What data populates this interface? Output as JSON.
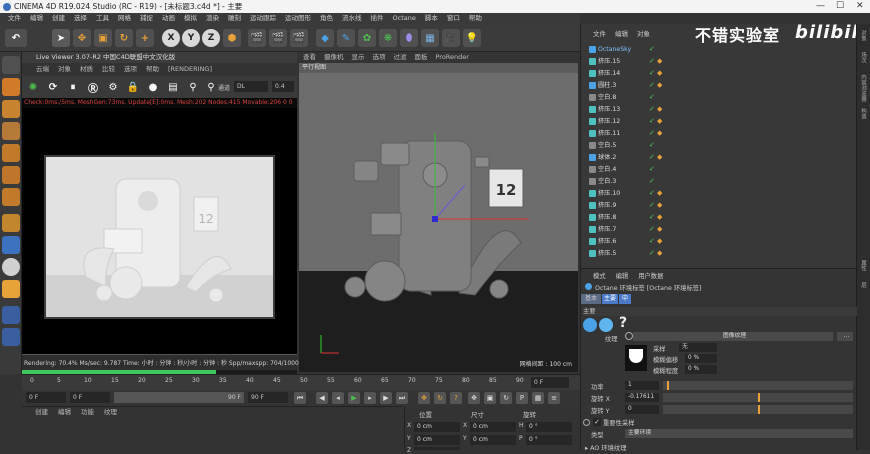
{
  "app": {
    "title": "CINEMA 4D R19.024 Studio (RC - R19) - [未标题3.c4d *] - 主要",
    "menu": [
      "文件",
      "编辑",
      "创建",
      "选择",
      "工具",
      "网格",
      "捕捉",
      "动画",
      "模拟",
      "渲染",
      "雕刻",
      "运动跟踪",
      "运动图形",
      "角色",
      "流水线",
      "插件",
      "Octane",
      "脚本",
      "窗口",
      "帮助"
    ]
  },
  "window_controls": {
    "minimize": "—",
    "maximize": "☐",
    "close": "✕"
  },
  "toolbar": {
    "axis_x": "X",
    "axis_y": "Y",
    "axis_z": "Z"
  },
  "live_viewer": {
    "title": "Live Viewer 3.07-R2 中国C4D联盟中文汉化版",
    "menu": [
      "云端",
      "对象",
      "材质",
      "比较",
      "选项",
      "帮助",
      "[RENDERING]"
    ],
    "channel_label": "通道",
    "channel_value": "DL",
    "channel_number": "0.4",
    "status": "Check:0ms./5ms. MeshGen:73ms. Update[E]:0ms. Mesh:202 Nodes:415 Movable:206  0  0",
    "render_status": "Rendering: 70.4%  Ms/sec: 9.787   Time: 小时 : 分钟 : 秒/小时 : 分钟 : 秒  Spp/maxspp: 704/1000  Tri: 0/84k",
    "render_progress": 0.704,
    "render_number": "12"
  },
  "viewport": {
    "menu": [
      "查看",
      "摄像机",
      "显示",
      "选项",
      "过滤",
      "面板",
      "ProRender"
    ],
    "title": "平行视图",
    "grid_spacing": "网格间距 : 100 cm",
    "calendar_number": "12"
  },
  "timeline": {
    "ticks": [
      "0",
      "5",
      "10",
      "15",
      "20",
      "25",
      "30",
      "35",
      "40",
      "45",
      "50",
      "55",
      "60",
      "65",
      "70",
      "75",
      "80",
      "85",
      "90"
    ],
    "current_frame": "0 F"
  },
  "playback": {
    "start": "0 F",
    "current": "0 F",
    "end_a": "90 F",
    "end_b": "90 F"
  },
  "material_manager": {
    "menu": [
      "创建",
      "编辑",
      "功能",
      "纹理"
    ]
  },
  "coordinates": {
    "headers": [
      "位置",
      "尺寸",
      "旋转"
    ],
    "rows": [
      {
        "axis": "X",
        "pos": "0 cm",
        "size_axis": "X",
        "size": "0 cm",
        "rot_axis": "H",
        "rot": "0 °"
      },
      {
        "axis": "Y",
        "pos": "0 cm",
        "size_axis": "Y",
        "size": "0 cm",
        "rot_axis": "P",
        "rot": "0 °"
      },
      {
        "axis": "Z",
        "pos": "0 cm",
        "size_axis": "Z",
        "size": "0 cm",
        "rot_axis": "B",
        "rot": "0 °"
      }
    ]
  },
  "object_manager": {
    "menu": [
      "文件",
      "编辑",
      "对象"
    ],
    "objects": [
      {
        "name": "OctaneSky",
        "color": "#4aa3e8",
        "tag": false,
        "highlight": true
      },
      {
        "name": "挤压.15",
        "color": "#4ec0c0",
        "tag": true
      },
      {
        "name": "挤压.14",
        "color": "#4ec0c0",
        "tag": true
      },
      {
        "name": "圆柱.3",
        "color": "#4aa3e8",
        "tag": true
      },
      {
        "name": "空白.8",
        "color": "#8a8a8a",
        "tag": false
      },
      {
        "name": "挤压.13",
        "color": "#4ec0c0",
        "tag": true
      },
      {
        "name": "挤压.12",
        "color": "#4ec0c0",
        "tag": true
      },
      {
        "name": "挤压.11",
        "color": "#4ec0c0",
        "tag": true
      },
      {
        "name": "空白.5",
        "color": "#8a8a8a",
        "tag": false
      },
      {
        "name": "球体.2",
        "color": "#4aa3e8",
        "tag": true
      },
      {
        "name": "空白.4",
        "color": "#8a8a8a",
        "tag": false
      },
      {
        "name": "空白.3",
        "color": "#8a8a8a",
        "tag": false
      },
      {
        "name": "挤压.10",
        "color": "#4ec0c0",
        "tag": true
      },
      {
        "name": "挤压.9",
        "color": "#4ec0c0",
        "tag": true
      },
      {
        "name": "挤压.8",
        "color": "#4ec0c0",
        "tag": true
      },
      {
        "name": "挤压.7",
        "color": "#4ec0c0",
        "tag": true
      },
      {
        "name": "挤压.6",
        "color": "#4ec0c0",
        "tag": true
      },
      {
        "name": "挤压.5",
        "color": "#4ec0c0",
        "tag": true
      }
    ]
  },
  "watermark": {
    "text": "不错实验室",
    "brand": "bilibili"
  },
  "right_strip": [
    "对象",
    "场次",
    "内容浏览器",
    "构造",
    "属性",
    "层"
  ],
  "attributes": {
    "menu": [
      "模式",
      "编辑",
      "用户数据"
    ],
    "title": "Octane 环境标签 [Octane 环境标签]",
    "tabs": [
      "基本",
      "主要",
      "中"
    ],
    "section": "主要",
    "texture_label": "纹理",
    "texture_value": "图像纹理",
    "texture_more": "...",
    "sub": {
      "sampling_label": "采样",
      "sampling_value": "无",
      "blur_label": "模糊偏移",
      "blur_value": "0 %",
      "blur2_label": "模糊程度",
      "blur2_value": "0 %"
    },
    "power_label": "功率",
    "power_value": "1",
    "power_fraction": 0.02,
    "rotx_label": "旋转 X",
    "rotx_value": "-0.17611",
    "rotx_fraction": 0.5,
    "roty_label": "旋转 Y",
    "roty_value": "0",
    "roty_fraction": 0.5,
    "importance_label": "重要性采样",
    "type_label": "类型",
    "type_value": "主要环境",
    "footer": "▸ AO 环境纹理"
  }
}
